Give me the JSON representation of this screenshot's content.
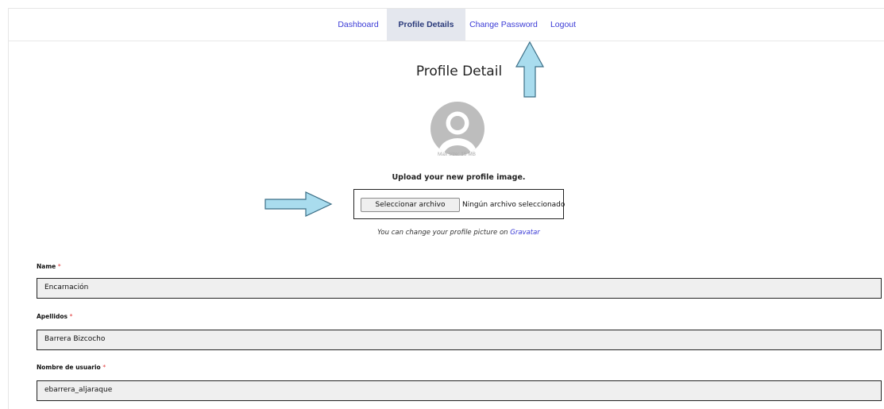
{
  "nav": {
    "items": [
      {
        "label": "Dashboard"
      },
      {
        "label": "Profile Details"
      },
      {
        "label": "Change Password"
      },
      {
        "label": "Logout"
      }
    ]
  },
  "profile": {
    "title": "Profile Detail",
    "max_size": "Max size: 15 MB",
    "upload_heading": "Upload your new profile image.",
    "file_button_label": "Seleccionar archivo",
    "file_status": "Ningún archivo seleccionado",
    "gravatar_text": "You can change your profile picture on",
    "gravatar_link": "Gravatar"
  },
  "form": {
    "fields": [
      {
        "label": "Name",
        "required_mark": "*",
        "value": "Encarnación"
      },
      {
        "label": "Apellidos",
        "required_mark": "*",
        "value": "Barrera Bizcocho"
      },
      {
        "label": "Nombre de usuario",
        "required_mark": "*",
        "value": "ebarrera_aljaraque"
      }
    ]
  },
  "colors": {
    "link": "#3b3bd6",
    "active_tab_bg": "#e4e7ee",
    "arrow_fill": "#a9dcee",
    "required": "#e23c3c"
  },
  "icons": {
    "avatar": "user-avatar-icon",
    "arrows": "annotation-arrow-icon"
  }
}
